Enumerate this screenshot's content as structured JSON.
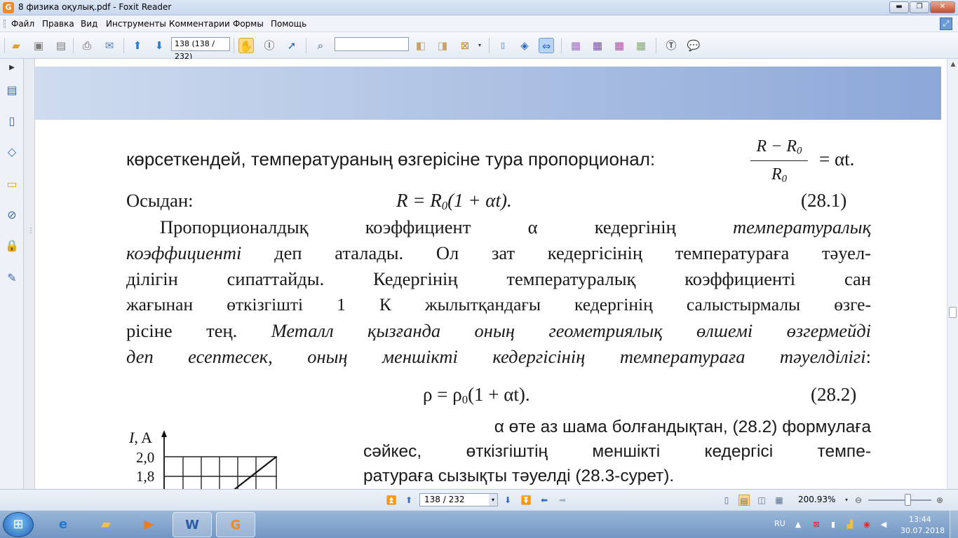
{
  "window": {
    "app_icon_letter": "G",
    "title": "8 физика оқулық.pdf - Foxit Reader",
    "min_glyph": "▬",
    "max_glyph": "❐",
    "close_glyph": "✕"
  },
  "menu": {
    "items": [
      "Файл",
      "Правка",
      "Вид",
      "Инструменты",
      "Комментарии",
      "Формы",
      "Помощь"
    ]
  },
  "toolbar": {
    "page_field_value": "138 (138 / 232)",
    "search_value": "",
    "icons": {
      "open": "open-folder-icon",
      "save": "save-icon",
      "save_as": "save-as-icon",
      "print": "print-icon",
      "hand": "hand-tool-icon",
      "find": "binoculars-icon"
    }
  },
  "document": {
    "line1": "көрсеткендей, температураның өзгерісіне тура пропорционал:",
    "frac_num": "R − R",
    "frac_num_sub": "0",
    "frac_den": "R",
    "frac_den_sub": "0",
    "frac_rhs": "= αt.",
    "line2_label": "Осыдан:",
    "eq1_a": "R = R",
    "eq1_sub": "0",
    "eq1_b": "(1 + αt).",
    "eq1_num": "(28.1)",
    "p1_l1_a": "Пропорционалдық коэффициент α кедергінің ",
    "p1_l1_it": "температуралық",
    "p1_l2_it": "коэффициенті",
    "p1_l2_b": " деп аталады. Ол зат кедергісінің температураға тәуел-",
    "p1_l3": "ділігін сипаттайды. Кедергінің температуралық коэффициенті сан",
    "p1_l4": "жағынан өткізгішті 1 К жылытқандағы кедергінің салыстырмалы өзге-",
    "p1_l5_a": "рісіне тең. ",
    "p1_l5_it": "Металл қызғанда оның геометриялық өлшемі өзгермейді",
    "p1_l6_it": "деп есептесек, оның меншікті кедергісінің температураға тәуелділігі",
    "p1_l6_end": ":",
    "eq2_a": "ρ = ρ",
    "eq2_sub": "0",
    "eq2_b": "(1 + αt).",
    "eq2_num": "(28.2)",
    "p2_l1": "α өте аз шама болғандықтан, (28.2) формулаға",
    "p2_l2": "сәйкес, өткізгіштің меншікті кедергісі темпе-",
    "p2_l3": "ратураға сызықты тәуелді (28.3-сурет).",
    "graph_ylabel_i": "I",
    "graph_ylabel_unit": ", A",
    "graph_tick_top": "2,0",
    "graph_tick_2": "1,8"
  },
  "statusbar": {
    "page_value": "138 / 232",
    "zoom": "200.93%"
  },
  "taskbar": {
    "lang": "RU",
    "time": "13:44",
    "date": "30.07.2018"
  }
}
